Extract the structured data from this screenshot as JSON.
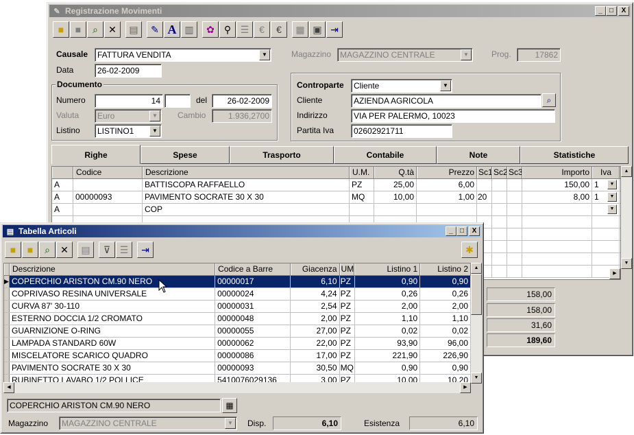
{
  "main": {
    "title": "Registrazione Movimenti",
    "labels": {
      "causale": "Causale",
      "data": "Data",
      "documento": "Documento",
      "numero": "Numero",
      "del": "del",
      "valuta": "Valuta",
      "cambio": "Cambio",
      "listino": "Listino",
      "magazzino": "Magazzino",
      "prog": "Prog.",
      "controparte": "Controparte",
      "cliente": "Cliente",
      "indirizzo": "Indirizzo",
      "partita_iva": "Partita Iva"
    },
    "values": {
      "causale": "FATTURA VENDITA",
      "data": "26-02-2009",
      "numero": "14",
      "numero2": "",
      "del": "26-02-2009",
      "valuta": "Euro",
      "cambio": "1.936,2700",
      "listino": "LISTINO1",
      "magazzino": "MAGAZZINO CENTRALE",
      "prog": "17862",
      "controparte": "Cliente",
      "cliente": "AZIENDA AGRICOLA",
      "indirizzo": "VIA PER PALERMO, 10023",
      "partita_iva": "02602921711"
    },
    "tabs": [
      "Righe",
      "Spese",
      "Trasporto",
      "Contabile",
      "Note",
      "Statistiche"
    ],
    "grid_headers": [
      "",
      "Codice",
      "Descrizione",
      "U.M.",
      "Q.tà",
      "Prezzo",
      "Sc1",
      "Sc2",
      "Sc3",
      "Importo",
      "Iva"
    ],
    "grid_rows": [
      [
        "A",
        "",
        "BATTISCOPA  RAFFAELLO",
        "PZ",
        "25,00",
        "6,00",
        "",
        "",
        "",
        "150,00",
        "1"
      ],
      [
        "A",
        "00000093",
        "PAVIMENTO SOCRATE 30 X 30",
        "MQ",
        "10,00",
        "1,00",
        "20",
        "",
        "",
        "8,00",
        "1"
      ],
      [
        "A",
        "",
        "COP",
        "",
        "",
        "",
        "",
        "",
        "",
        "",
        ""
      ]
    ],
    "totals": [
      "158,00",
      "158,00",
      "31,60",
      "189,60"
    ]
  },
  "articoli": {
    "title": "Tabella Articoli",
    "headers": [
      "Descrizione",
      "Codice a Barre",
      "Giacenza",
      "UM",
      "Listino 1",
      "Listino 2"
    ],
    "rows": [
      [
        "COPERCHIO ARISTON CM.90 NERO",
        "00000017",
        "6,10",
        "PZ",
        "0,90",
        "0,90"
      ],
      [
        "COPRIVASO RESINA UNIVERSALE",
        "00000024",
        "4,24",
        "PZ",
        "0,26",
        "0,26"
      ],
      [
        "CURVA 87' 30-110",
        "00000031",
        "2,54",
        "PZ",
        "2,00",
        "2,00"
      ],
      [
        "ESTERNO DOCCIA 1/2 CROMATO",
        "00000048",
        "2,00",
        "PZ",
        "1,10",
        "1,10"
      ],
      [
        "GUARNIZIONE O-RING",
        "00000055",
        "27,00",
        "PZ",
        "0,02",
        "0,02"
      ],
      [
        "LAMPADA STANDARD 60W",
        "00000062",
        "22,00",
        "PZ",
        "93,90",
        "96,00"
      ],
      [
        "MISCELATORE SCARICO QUADRO",
        "00000086",
        "17,00",
        "PZ",
        "221,90",
        "226,90"
      ],
      [
        "PAVIMENTO SOCRATE 30 X 30",
        "00000093",
        "30,50",
        "MQ",
        "0,90",
        "0,90"
      ],
      [
        "RUBINETTO LAVABO 1/2 POLLICE",
        "5410076029136",
        "3,00",
        "PZ",
        "10,00",
        "10,20"
      ]
    ],
    "selected_desc": "COPERCHIO ARISTON CM.90 NERO",
    "magazzino_label": "Magazzino",
    "magazzino_value": "MAGAZZINO CENTRALE",
    "disp_label": "Disp.",
    "disp_value": "6,10",
    "esistenza_label": "Esistenza",
    "esistenza_value": "6,10"
  },
  "window_buttons": {
    "min": "_",
    "max": "□",
    "close": "X"
  },
  "icons": {
    "folder": "📁",
    "open": "📂",
    "search": "🔍",
    "delete": "✕",
    "print": "🖨",
    "edit": "✎",
    "font": "A",
    "barcode": "▥",
    "palette": "🎨",
    "binoculars": "🔭",
    "list": "☰",
    "exit": "⇥",
    "filter": "∀",
    "new": "✱",
    "arrow": "▼",
    "marker": "▶"
  }
}
